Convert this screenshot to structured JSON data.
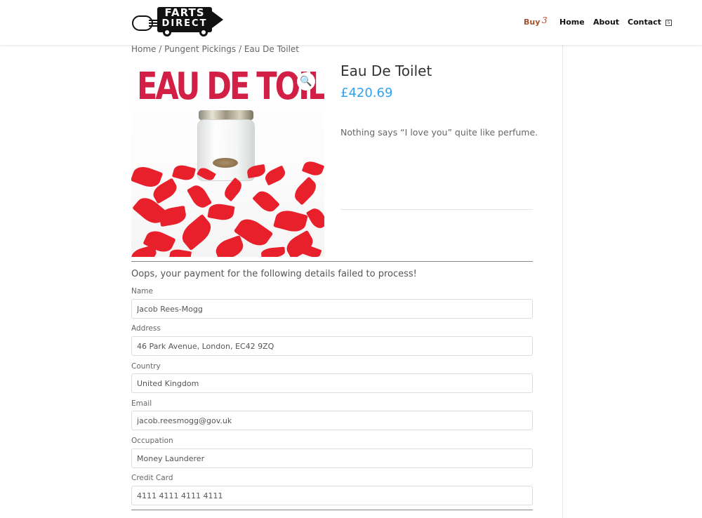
{
  "header": {
    "logo": {
      "line1": "FARTS",
      "line2": "DIRECT"
    },
    "nav": {
      "buy": "Buy",
      "cart_count": "3",
      "home": "Home",
      "about": "About",
      "contact": "Contact"
    },
    "search_icon": "search-icon"
  },
  "breadcrumb": {
    "home": "Home",
    "sep1": " / ",
    "category": "Pungent Pickings",
    "sep2": " / ",
    "current": "Eau De Toilet"
  },
  "product": {
    "image_title": "EAU DE TOILET",
    "title": "Eau De Toilet",
    "price": "£420.69",
    "description": "Nothing says “I love you” quite like perfume.",
    "zoom_icon": "magnifier-icon"
  },
  "form": {
    "error_message": "Oops, your payment for the following details failed to process!",
    "fields": [
      {
        "label": "Name",
        "value": "Jacob Rees-Mogg"
      },
      {
        "label": "Address",
        "value": "46 Park Avenue, London, EC42 9ZQ"
      },
      {
        "label": "Country",
        "value": "United Kingdom"
      },
      {
        "label": "Email",
        "value": "jacob.reesmogg@gov.uk"
      },
      {
        "label": "Occupation",
        "value": "Money Launderer"
      },
      {
        "label": "Credit Card",
        "value": "4111 4111 4111 4111"
      }
    ]
  },
  "colors": {
    "accent_price": "#2ea3f2",
    "nav_buy": "#a0522d",
    "image_title": "#d21f45",
    "petals": "#e8202c"
  }
}
